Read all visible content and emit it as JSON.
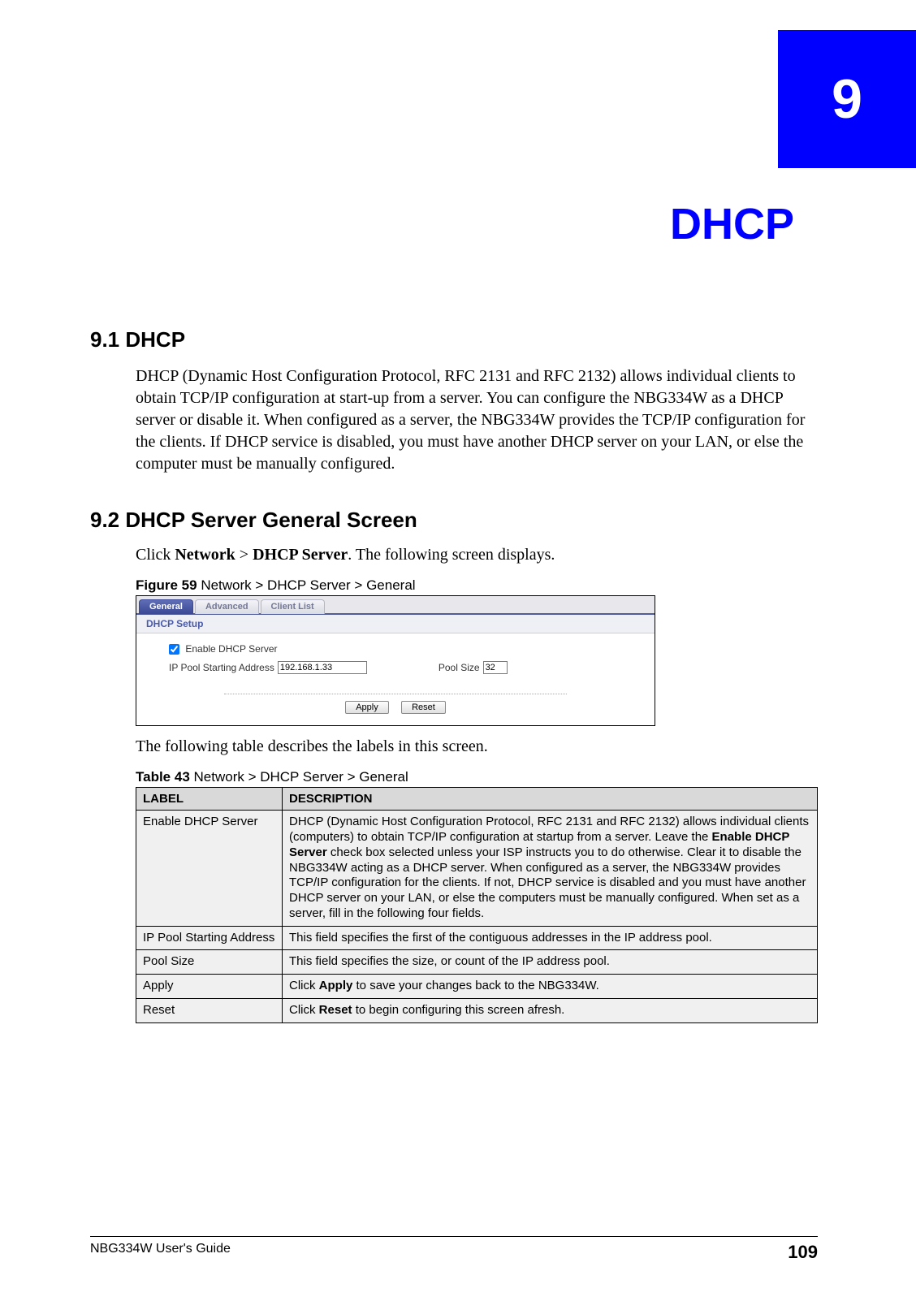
{
  "chapter": {
    "number": "9",
    "title": "DHCP"
  },
  "section_9_1": {
    "heading": "9.1  DHCP",
    "body": "DHCP (Dynamic Host Configuration Protocol, RFC 2131 and RFC 2132) allows individual clients to obtain TCP/IP configuration at start-up from a server. You can configure the NBG334W as a DHCP server or disable it. When configured as a server, the NBG334W provides the TCP/IP configuration for the clients. If DHCP service is disabled, you must have another DHCP server on your LAN, or else the computer must be manually configured."
  },
  "section_9_2": {
    "heading": "9.2  DHCP Server General Screen",
    "instr_pre": "Click ",
    "instr_b1": "Network",
    "instr_mid": " > ",
    "instr_b2": "DHCP Server",
    "instr_post": ". The following screen displays.",
    "figure_label": "Figure 59",
    "figure_caption": "   Network > DHCP Server > General",
    "after_figure": "The following table describes the labels in this screen.",
    "table_label": "Table 43",
    "table_caption": "   Network > DHCP Server > General"
  },
  "ui": {
    "tabs": {
      "general": "General",
      "advanced": "Advanced",
      "client_list": "Client List"
    },
    "panel_title": "DHCP Setup",
    "enable_label": "Enable DHCP Server",
    "ip_label": "IP Pool Starting Address",
    "ip_value": "192.168.1.33",
    "pool_label": "Pool Size",
    "pool_value": "32",
    "apply": "Apply",
    "reset": "Reset"
  },
  "table": {
    "head_label": "LABEL",
    "head_desc": "DESCRIPTION",
    "rows": [
      {
        "label": "Enable DHCP Server",
        "desc_pre": "DHCP (Dynamic Host Configuration Protocol, RFC 2131 and RFC 2132) allows individual clients (computers) to obtain TCP/IP configuration at startup from a server. Leave the ",
        "desc_bold": "Enable DHCP Server",
        "desc_post": " check box selected unless your ISP instructs you to do otherwise. Clear it to disable the NBG334W acting as a DHCP server. When configured as a server, the NBG334W provides TCP/IP configuration for the clients. If not, DHCP service is disabled and you must have another DHCP server on your LAN, or else the computers must be manually configured. When set as a server, fill in the following four fields."
      },
      {
        "label": "IP Pool Starting Address",
        "desc_pre": "This field specifies the first of the contiguous addresses in the IP address pool.",
        "desc_bold": "",
        "desc_post": ""
      },
      {
        "label": "Pool Size",
        "desc_pre": "This field specifies the size, or count of the IP address pool.",
        "desc_bold": "",
        "desc_post": ""
      },
      {
        "label": "Apply",
        "desc_pre": "Click ",
        "desc_bold": "Apply",
        "desc_post": " to save your changes back to the NBG334W."
      },
      {
        "label": "Reset",
        "desc_pre": "Click ",
        "desc_bold": "Reset",
        "desc_post": " to begin configuring this screen afresh."
      }
    ]
  },
  "footer": {
    "guide": "NBG334W User's Guide",
    "page": "109"
  }
}
